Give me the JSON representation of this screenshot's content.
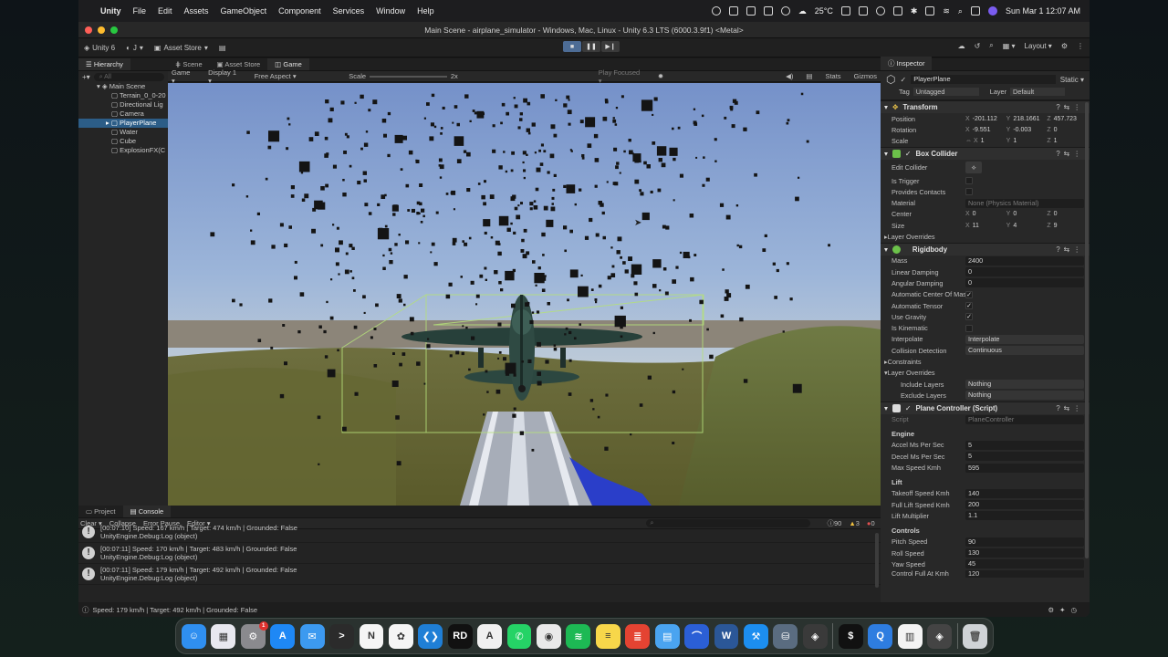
{
  "menubar": {
    "app_name": "Unity",
    "menus": [
      "File",
      "Edit",
      "Assets",
      "GameObject",
      "Component",
      "Services",
      "Window",
      "Help"
    ],
    "weather": "25°C",
    "clock": "Sun Mar 1  12:07 AM"
  },
  "window": {
    "title": "Main Scene - airplane_simulator - Windows, Mac, Linux - Unity 6.3 LTS (6000.3.9f1) <Metal>"
  },
  "toolbar": {
    "unity_label": "Unity 6",
    "account_label": "J",
    "asset_store_label": "Asset Store",
    "layout_label": "Layout"
  },
  "hierarchy": {
    "tab_label": "Hierarchy",
    "search_placeholder": "All",
    "scene_name": "Main Scene",
    "items": [
      {
        "label": "Terrain_0_0-20"
      },
      {
        "label": "Directional Lig"
      },
      {
        "label": "Camera"
      },
      {
        "label": "PlayerPlane"
      },
      {
        "label": "Water"
      },
      {
        "label": "Cube"
      },
      {
        "label": "ExplosionFX(C"
      }
    ]
  },
  "game_view": {
    "tabs": [
      "Scene",
      "Asset Store",
      "Game"
    ],
    "mode": "Game",
    "display": "Display 1",
    "aspect": "Free Aspect",
    "scale_label": "Scale",
    "scale_value": "2x",
    "play_focused": "Play Focused",
    "stats": "Stats",
    "gizmos": "Gizmos"
  },
  "inspector": {
    "tab_label": "Inspector",
    "object_name": "PlayerPlane",
    "static_label": "Static",
    "tag_label": "Tag",
    "tag_value": "Untagged",
    "layer_label": "Layer",
    "layer_value": "Default",
    "transform": {
      "title": "Transform",
      "position": {
        "label": "Position",
        "x": "-201.112",
        "y": "218.1661",
        "z": "457.723"
      },
      "rotation": {
        "label": "Rotation",
        "x": "-9.551",
        "y": "-0.003",
        "z": "0"
      },
      "scale": {
        "label": "Scale",
        "x": "1",
        "y": "1",
        "z": "1"
      }
    },
    "box_collider": {
      "title": "Box Collider",
      "edit_collider": "Edit Collider",
      "is_trigger": "Is Trigger",
      "provides_contacts": "Provides Contacts",
      "material_label": "Material",
      "material_value": "None (Physics Material)",
      "center": {
        "label": "Center",
        "x": "0",
        "y": "0",
        "z": "0"
      },
      "size": {
        "label": "Size",
        "x": "11",
        "y": "4",
        "z": "9"
      },
      "layer_overrides": "Layer Overrides"
    },
    "rigidbody": {
      "title": "Rigidbody",
      "rows": [
        {
          "label": "Mass",
          "value": "2400"
        },
        {
          "label": "Linear Damping",
          "value": "0"
        },
        {
          "label": "Angular Damping",
          "value": "0"
        }
      ],
      "checks": [
        {
          "label": "Automatic Center Of Mass",
          "checked": "✓"
        },
        {
          "label": "Automatic Tensor",
          "checked": "✓"
        },
        {
          "label": "Use Gravity",
          "checked": "✓"
        },
        {
          "label": "Is Kinematic",
          "checked": ""
        }
      ],
      "interpolate_label": "Interpolate",
      "interpolate_value": "Interpolate",
      "collision_label": "Collision Detection",
      "collision_value": "Continuous",
      "constraints": "Constraints",
      "layer_overrides": "Layer Overrides",
      "include_label": "Include Layers",
      "include_value": "Nothing",
      "exclude_label": "Exclude Layers",
      "exclude_value": "Nothing"
    },
    "plane_controller": {
      "title": "Plane Controller (Script)",
      "script_label": "Script",
      "script_value": "PlaneController",
      "engine_header": "Engine",
      "engine": [
        {
          "label": "Accel Ms Per Sec",
          "value": "5"
        },
        {
          "label": "Decel Ms Per Sec",
          "value": "5"
        },
        {
          "label": "Max Speed Kmh",
          "value": "595"
        }
      ],
      "lift_header": "Lift",
      "lift": [
        {
          "label": "Takeoff Speed Kmh",
          "value": "140"
        },
        {
          "label": "Full Lift Speed Kmh",
          "value": "200"
        },
        {
          "label": "Lift Multiplier",
          "value": "1.1"
        }
      ],
      "controls_header": "Controls",
      "controls": [
        {
          "label": "Pitch Speed",
          "value": "90"
        },
        {
          "label": "Roll Speed",
          "value": "130"
        },
        {
          "label": "Yaw Speed",
          "value": "45"
        },
        {
          "label": "Control Full At Kmh",
          "value": "120"
        }
      ]
    }
  },
  "console": {
    "tabs": [
      "Project",
      "Console"
    ],
    "clear": "Clear",
    "collapse": "Collapse",
    "error_pause": "Error Pause",
    "editor": "Editor",
    "count_info": "90",
    "count_warn": "3",
    "count_error": "0",
    "entries": [
      {
        "line1": "[00:07:10] Speed: 167 km/h | Target: 474 km/h | Grounded: False",
        "line2": "UnityEngine.Debug:Log (object)"
      },
      {
        "line1": "[00:07:11] Speed: 170 km/h | Target: 483 km/h | Grounded: False",
        "line2": "UnityEngine.Debug:Log (object)"
      },
      {
        "line1": "[00:07:11] Speed: 179 km/h | Target: 492 km/h | Grounded: False",
        "line2": "UnityEngine.Debug:Log (object)"
      }
    ]
  },
  "status_bar": {
    "message": "Speed: 179 km/h | Target: 492 km/h | Grounded: False"
  },
  "dock": {
    "apps": [
      {
        "name": "finder-icon",
        "color": "#2f8ff0",
        "glyph": "☺"
      },
      {
        "name": "launchpad-icon",
        "color": "#e8e8ef",
        "glyph": "▦"
      },
      {
        "name": "system-settings-icon",
        "color": "#8a8a8e",
        "glyph": "⚙"
      },
      {
        "name": "app-store-icon",
        "color": "#1e88f5",
        "glyph": "A"
      },
      {
        "name": "mail-icon",
        "color": "#3c9af0",
        "glyph": "✉"
      },
      {
        "name": "terminal-icon",
        "color": "#2b2b2b",
        "glyph": ">"
      },
      {
        "name": "notion-icon",
        "color": "#f5f5f5",
        "glyph": "N"
      },
      {
        "name": "chatgpt-icon",
        "color": "#f5f5f5",
        "glyph": "✿"
      },
      {
        "name": "vscode-icon",
        "color": "#1f7fd6",
        "glyph": "❮❯"
      },
      {
        "name": "rider-icon",
        "color": "#111111",
        "glyph": "RD"
      },
      {
        "name": "xcode-tools-icon",
        "color": "#f0f0f0",
        "glyph": "A"
      },
      {
        "name": "whatsapp-icon",
        "color": "#25d366",
        "glyph": "✆"
      },
      {
        "name": "chrome-icon",
        "color": "#e9e9e9",
        "glyph": "◉"
      },
      {
        "name": "spotify-icon",
        "color": "#1db954",
        "glyph": "≋"
      },
      {
        "name": "notes-icon",
        "color": "#f7d74a",
        "glyph": "≡"
      },
      {
        "name": "todoist-icon",
        "color": "#e44332",
        "glyph": "≣"
      },
      {
        "name": "files-icon",
        "color": "#4aa4f0",
        "glyph": "▤"
      },
      {
        "name": "arc-icon",
        "color": "#2b5fd6",
        "glyph": "⌒"
      },
      {
        "name": "word-icon",
        "color": "#2b5797",
        "glyph": "W"
      },
      {
        "name": "xcode-icon",
        "color": "#1c8ef0",
        "glyph": "⚒"
      },
      {
        "name": "database-icon",
        "color": "#5a6c80",
        "glyph": "⛁"
      },
      {
        "name": "unity-hub-icon",
        "color": "#3a3a3a",
        "glyph": "◈"
      },
      {
        "name": "iterm-icon",
        "color": "#111111",
        "glyph": "$"
      },
      {
        "name": "quicktime-icon",
        "color": "#2e7de0",
        "glyph": "Q"
      },
      {
        "name": "preview-icon",
        "color": "#f3f3f3",
        "glyph": "▥"
      },
      {
        "name": "unity-icon",
        "color": "#444444",
        "glyph": "◈"
      }
    ],
    "system_settings_badge": "1"
  }
}
